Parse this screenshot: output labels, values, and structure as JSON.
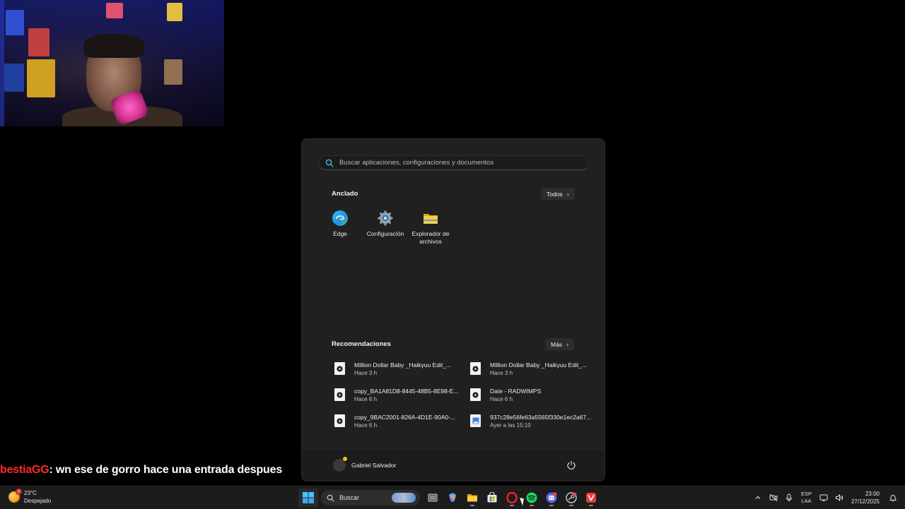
{
  "chat": {
    "username": "bestiaGG",
    "message": ": wn ese de gorro hace una entrada despues"
  },
  "start_menu": {
    "search_placeholder": "Buscar aplicaciones, configuraciones y documentos",
    "pinned_title": "Anclado",
    "all_label": "Todos",
    "pinned": [
      {
        "label": "Edge",
        "icon": "edge-icon"
      },
      {
        "label": "Configuración",
        "icon": "gear-icon"
      },
      {
        "label": "Explorador de archivos",
        "icon": "folder-icon"
      }
    ],
    "recommended_title": "Recomendaciones",
    "more_label": "Más",
    "recommended": [
      {
        "name": "Million Dollar Baby _Haikyuu Edit_...",
        "time": "Hace 3 h",
        "icon": "video-file-icon"
      },
      {
        "name": "Million Dollar Baby _Haikyuu Edit_...",
        "time": "Hace 3 h",
        "icon": "video-file-icon"
      },
      {
        "name": "copy_BA1A81D8-8445-48B5-8E98-E...",
        "time": "Hace 6 h",
        "icon": "video-file-icon"
      },
      {
        "name": "Date - RADWIMPS",
        "time": "Hace 6 h",
        "icon": "video-file-icon"
      },
      {
        "name": "copy_9BAC2001-826A-4D1E-90A0-...",
        "time": "Hace 6 h",
        "icon": "video-file-icon"
      },
      {
        "name": "937c28e56fe63a5565f330e1ec2a67...",
        "time": "Ayer a las 15:10",
        "icon": "image-file-icon"
      }
    ],
    "user_name": "Gabriel Salvador"
  },
  "taskbar": {
    "weather_temp": "23°C",
    "weather_desc": "Despejado",
    "weather_badge": "8",
    "search_label": "Buscar",
    "lang_top": "ESP",
    "lang_bottom": "LAA",
    "time": "23:00",
    "date": "27/12/2025"
  },
  "colors": {
    "accent": "#0078d4",
    "menu_bg": "#202020",
    "taskbar_bg": "#1c1c1c",
    "chat_user": "#ff2a2a"
  }
}
